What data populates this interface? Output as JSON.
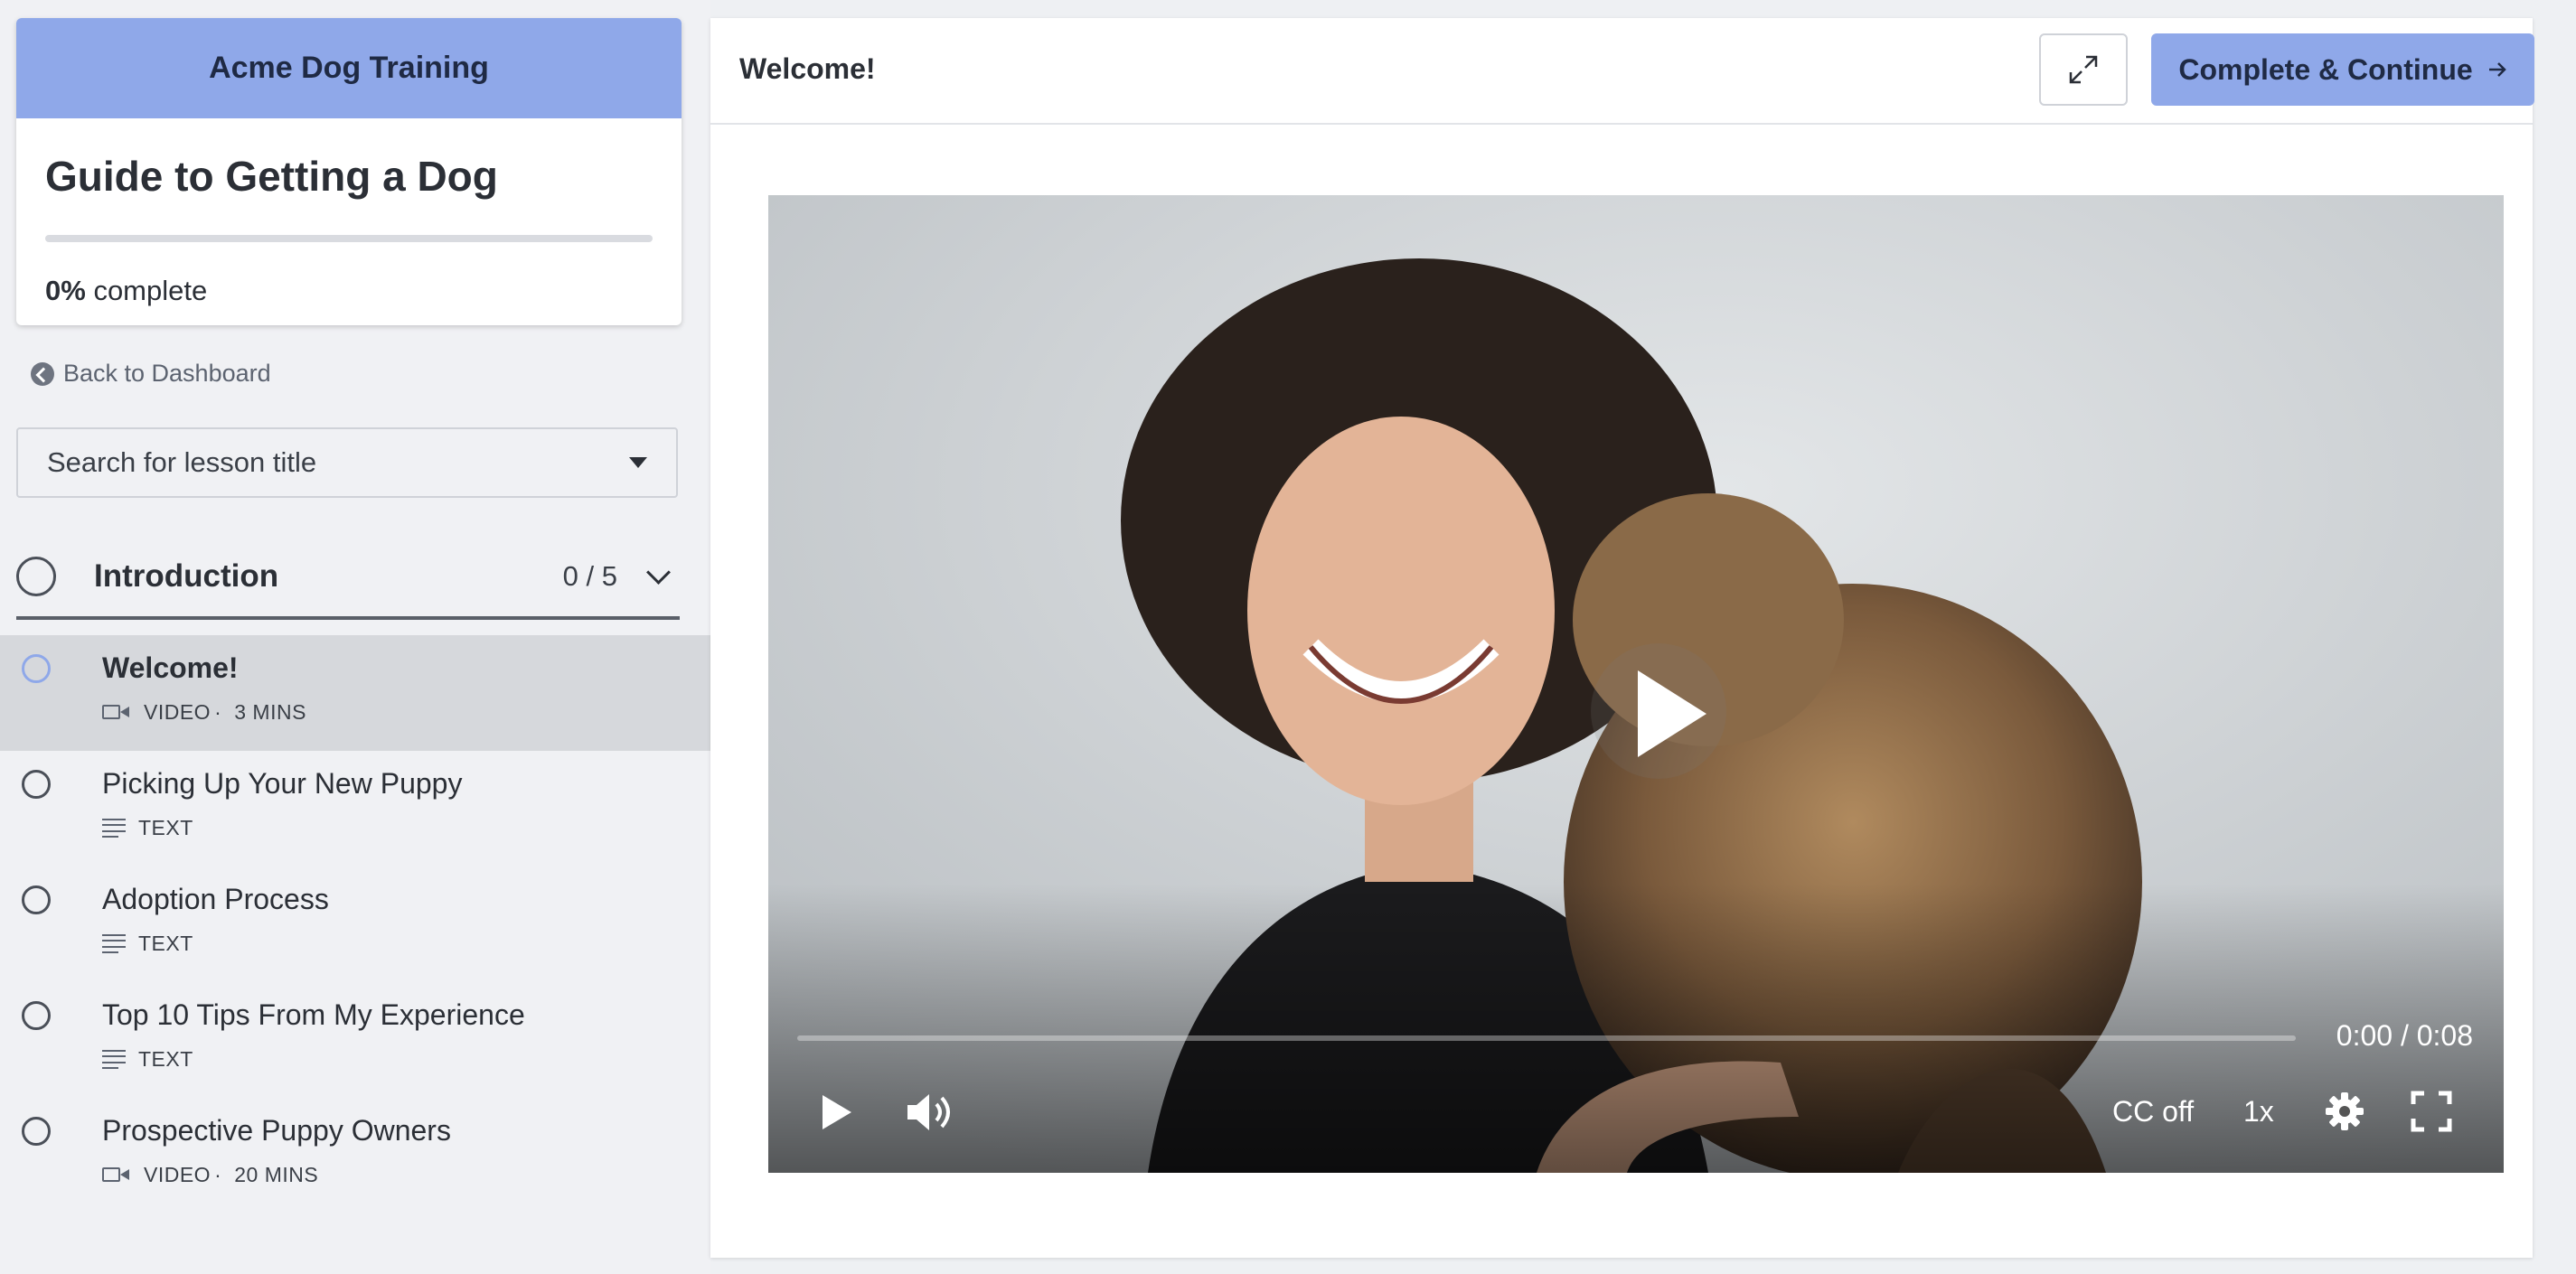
{
  "course": {
    "school_name": "Acme Dog Training",
    "title": "Guide to Getting a Dog",
    "progress_percent_value": 0,
    "progress_percent": "0%",
    "progress_suffix": "complete"
  },
  "sidebar": {
    "back_link": "Back to Dashboard",
    "search_placeholder": "Search for lesson title",
    "chapter": {
      "title": "Introduction",
      "count": "0 / 5"
    },
    "lessons": [
      {
        "title": "Welcome!",
        "type": "VIDEO",
        "duration": "3 MINS",
        "icon": "video-icon",
        "active": true
      },
      {
        "title": "Picking Up Your New Puppy",
        "type": "TEXT",
        "icon": "text-icon",
        "active": false
      },
      {
        "title": "Adoption Process",
        "type": "TEXT",
        "icon": "text-icon",
        "active": false
      },
      {
        "title": "Top 10 Tips From My Experience",
        "type": "TEXT",
        "icon": "text-icon",
        "active": false
      },
      {
        "title": "Prospective Puppy Owners",
        "type": "VIDEO",
        "duration": "20 MINS",
        "icon": "video-icon",
        "active": false
      }
    ]
  },
  "header": {
    "lesson_title": "Welcome!",
    "complete_button": "Complete & Continue",
    "expand_icon": "expand-arrows-icon",
    "complete_icon": "arrow-right-icon"
  },
  "player": {
    "time": "0:00 / 0:08",
    "captions": "CC off",
    "speed": "1x",
    "progress_fraction": 0,
    "icons": [
      "play-icon",
      "volume-icon",
      "settings-gear-icon",
      "fullscreen-icon"
    ]
  },
  "colors": {
    "accent": "#8fa8e9",
    "active_row": "#d6d8dc",
    "sidebar_bg": "#f0f1f4"
  }
}
